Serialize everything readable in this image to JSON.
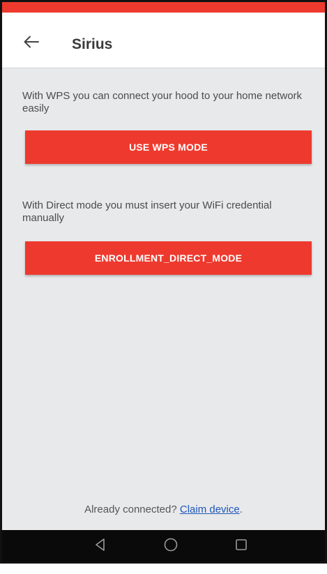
{
  "header": {
    "title": "Sirius",
    "back_icon": "arrow-left-icon"
  },
  "wps": {
    "description": "With WPS you can connect your hood to your home network easily",
    "button_label": "USE WPS MODE"
  },
  "direct": {
    "description": "With Direct mode you must insert your WiFi credential manually",
    "button_label": "ENROLLMENT_DIRECT_MODE"
  },
  "footer": {
    "prefix": "Already connected? ",
    "link_label": "Claim device",
    "suffix": "."
  },
  "nav_bar": {
    "back_icon": "triangle-back-icon",
    "home_icon": "circle-home-icon",
    "recent_icon": "square-recents-icon"
  },
  "colors": {
    "accent": "#ee3a2e",
    "background": "#e8e9eb",
    "link": "#1e57b8",
    "nav_bar": "#0a0a0a"
  }
}
